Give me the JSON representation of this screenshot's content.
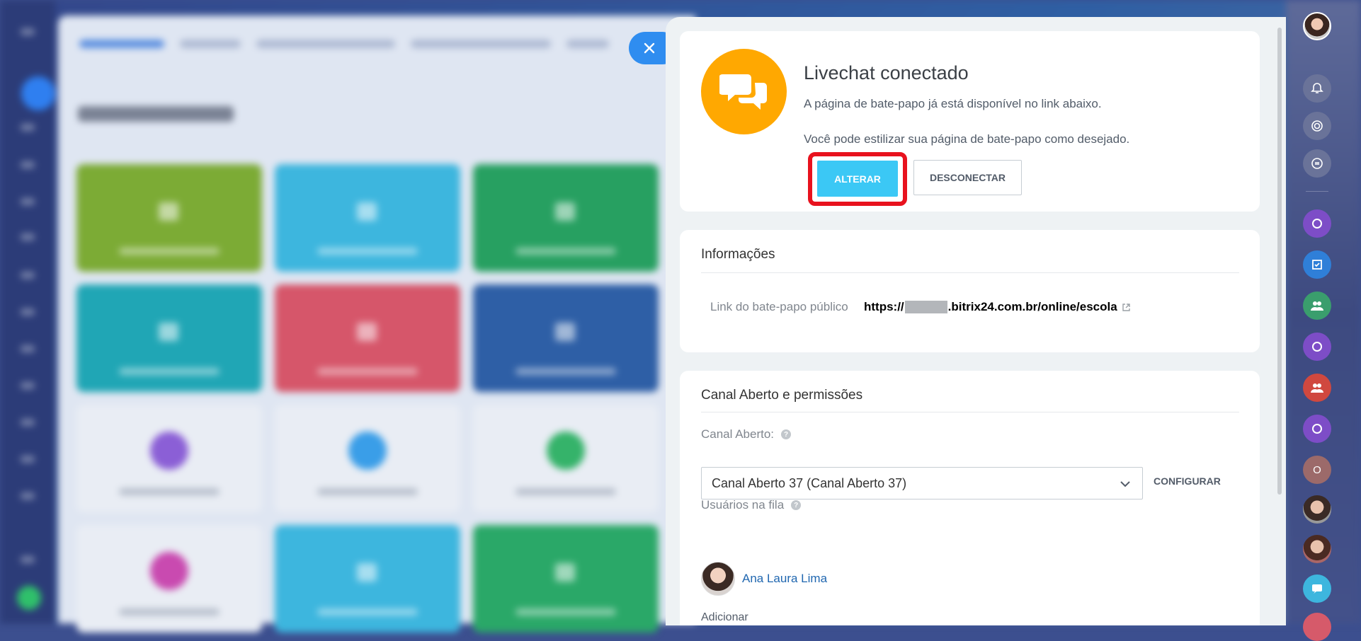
{
  "close_button": {
    "icon": "close-icon"
  },
  "status_card": {
    "icon": "chat-bubbles-icon",
    "title": "Livechat conectado",
    "line1": "A página de bate-papo já está disponível no link abaixo.",
    "line2": "Você pode estilizar sua página de bate-papo como desejado.",
    "alterar_label": "ALTERAR",
    "desconectar_label": "DESCONECTAR"
  },
  "info_card": {
    "title": "Informações",
    "link_label": "Link do bate-papo público",
    "link_prefix": "https://",
    "link_suffix": ".bitrix24.com.br/online/escola"
  },
  "channel_card": {
    "title": "Canal Aberto e permissões",
    "channel_label": "Canal Aberto:",
    "channel_value": "Canal Aberto 37 (Canal Aberto 37)",
    "configure_label": "CONFIGURAR",
    "queue_label": "Usuários na fila",
    "queue_user": "Ana Laura Lima",
    "add_label": "Adicionar"
  },
  "right_bar": {
    "letter_avatar": "O"
  },
  "colors": {
    "accent_button": "#3bc8f5",
    "highlight": "#e8121e",
    "chat_icon_bg": "#ffa801",
    "link": "#2067b0"
  }
}
